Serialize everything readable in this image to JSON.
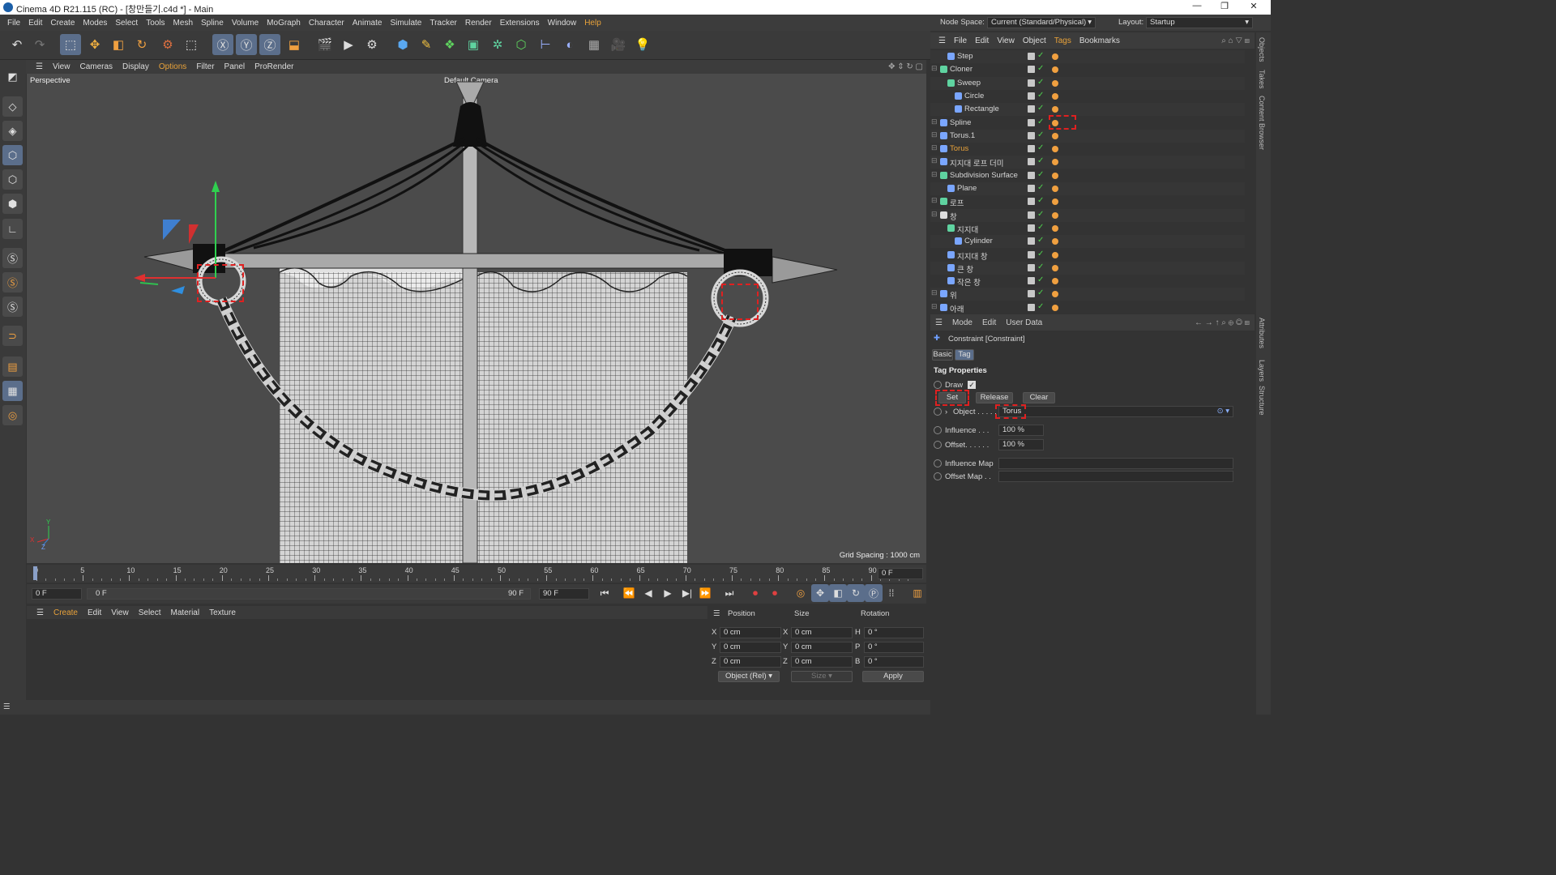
{
  "window": {
    "title": "Cinema 4D R21.115 (RC) - [창만들기.c4d *] - Main"
  },
  "menubar": {
    "items": [
      "File",
      "Edit",
      "Create",
      "Modes",
      "Select",
      "Tools",
      "Mesh",
      "Spline",
      "Volume",
      "MoGraph",
      "Character",
      "Animate",
      "Simulate",
      "Tracker",
      "Render",
      "Extensions",
      "Window",
      "Help"
    ]
  },
  "node_space": {
    "label": "Node Space:",
    "value": "Current (Standard/Physical)",
    "layout_label": "Layout:",
    "layout_value": "Startup"
  },
  "viewport": {
    "menu": [
      "View",
      "Cameras",
      "Display",
      "Options",
      "Filter",
      "Panel",
      "ProRender"
    ],
    "view_name": "Perspective",
    "camera": "Default Camera",
    "grid_spacing": "Grid Spacing : 1000 cm",
    "axis": {
      "x": "X",
      "y": "Y",
      "z": "Z"
    }
  },
  "timeline": {
    "ticks": [
      "0",
      "5",
      "10",
      "15",
      "20",
      "25",
      "30",
      "35",
      "40",
      "45",
      "50",
      "55",
      "60",
      "65",
      "70",
      "75",
      "80",
      "85",
      "90"
    ],
    "current_frame": "0 F"
  },
  "playback": {
    "start": "0 F",
    "range_start": "0 F",
    "range_end": "90 F",
    "end": "90 F"
  },
  "material_menu": [
    "Create",
    "Edit",
    "View",
    "Select",
    "Material",
    "Texture"
  ],
  "coordinates": {
    "headers": {
      "position": "Position",
      "size": "Size",
      "rotation": "Rotation"
    },
    "rows": [
      {
        "axis": "X",
        "pos": "0 cm",
        "size_axis": "X",
        "size": "0 cm",
        "rot_axis": "H",
        "rot": "0 °"
      },
      {
        "axis": "Y",
        "pos": "0 cm",
        "size_axis": "Y",
        "size": "0 cm",
        "rot_axis": "P",
        "rot": "0 °"
      },
      {
        "axis": "Z",
        "pos": "0 cm",
        "size_axis": "Z",
        "size": "0 cm",
        "rot_axis": "B",
        "rot": "0 °"
      }
    ],
    "mode": "Object (Rel)",
    "size_mode": "Size",
    "apply": "Apply"
  },
  "objects": {
    "menu": [
      "File",
      "Edit",
      "View",
      "Object",
      "Tags",
      "Bookmarks"
    ],
    "items": [
      {
        "name": "Step",
        "indent": 1,
        "color": "#7aa6ff"
      },
      {
        "name": "Cloner",
        "indent": 0,
        "color": "#5fd3a0"
      },
      {
        "name": "Sweep",
        "indent": 1,
        "color": "#5fd3a0"
      },
      {
        "name": "Circle",
        "indent": 2,
        "color": "#7aa6ff"
      },
      {
        "name": "Rectangle",
        "indent": 2,
        "color": "#7aa6ff"
      },
      {
        "name": "Spline",
        "indent": 0,
        "color": "#7aa6ff"
      },
      {
        "name": "Torus.1",
        "indent": 0,
        "color": "#7aa6ff"
      },
      {
        "name": "Torus",
        "indent": 0,
        "color": "#7aa6ff",
        "highlight": true
      },
      {
        "name": "지지대 로프 더미",
        "indent": 0,
        "color": "#7aa6ff"
      },
      {
        "name": "Subdivision Surface",
        "indent": 0,
        "color": "#5fd3a0"
      },
      {
        "name": "Plane",
        "indent": 1,
        "color": "#7aa6ff"
      },
      {
        "name": "로프",
        "indent": 0,
        "color": "#5fd3a0"
      },
      {
        "name": "창",
        "indent": 0,
        "color": "#dddddd"
      },
      {
        "name": "지지대",
        "indent": 1,
        "color": "#5fd3a0"
      },
      {
        "name": "Cylinder",
        "indent": 2,
        "color": "#7aa6ff"
      },
      {
        "name": "지지대 창",
        "indent": 1,
        "color": "#7aa6ff"
      },
      {
        "name": "큰 창",
        "indent": 1,
        "color": "#7aa6ff"
      },
      {
        "name": "작은 창",
        "indent": 1,
        "color": "#7aa6ff"
      },
      {
        "name": "위",
        "indent": 0,
        "color": "#7aa6ff"
      },
      {
        "name": "아래",
        "indent": 0,
        "color": "#7aa6ff"
      }
    ]
  },
  "attributes": {
    "menu": [
      "Mode",
      "Edit",
      "User Data"
    ],
    "title": "Constraint [Constraint]",
    "tabs": [
      "Basic",
      "Tag"
    ],
    "section": "Tag Properties",
    "draw_label": "Draw",
    "buttons": [
      "Set",
      "Release",
      "Clear"
    ],
    "object_label": "Object . . . . .",
    "object_value": "Torus",
    "influence_label": "Influence . . .",
    "influence_value": "100 %",
    "offset_label": "Offset. . . . . .",
    "offset_value": "100 %",
    "influence_map_label": "Influence Map",
    "offset_map_label": "Offset Map . ."
  },
  "side_tabs": {
    "top": [
      "Objects",
      "Takes",
      "Content Browser"
    ],
    "bottom": [
      "Attributes",
      "Layers",
      "Structure"
    ]
  },
  "colors": {
    "accent": "#e8a23a",
    "selection": "#5b6e8b",
    "annotation": "#e02020"
  }
}
